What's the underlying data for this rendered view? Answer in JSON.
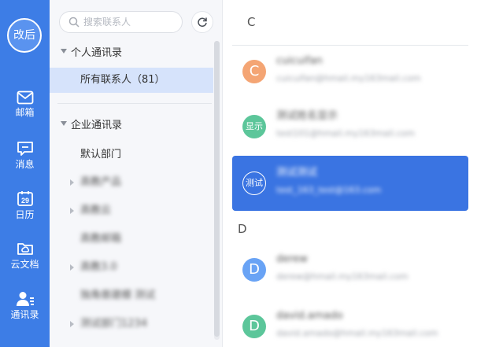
{
  "colors": {
    "nav_bg": "#3d7de6",
    "selected_bg": "#3a74e2",
    "active_row_bg": "#d6e3fb"
  },
  "nav": {
    "avatar_text": "改后",
    "items": [
      {
        "label": "邮箱",
        "icon": "mail-icon"
      },
      {
        "label": "消息",
        "icon": "message-icon"
      },
      {
        "label": "日历",
        "icon": "calendar-icon",
        "icon_text": "29"
      },
      {
        "label": "云文档",
        "icon": "cloud-folder-icon"
      },
      {
        "label": "通讯录",
        "icon": "contacts-icon",
        "active": true
      }
    ]
  },
  "sidebar": {
    "search_placeholder": "搜索联系人",
    "personal": {
      "title": "个人通讯录",
      "all_contacts": "所有联系人（81）"
    },
    "enterprise": {
      "title": "企业通讯录",
      "items": [
        "默认部门",
        "高教产品",
        "高教云",
        "高教邮箱",
        "高教3.0",
        "独角兽建模 测试",
        "测试部门1234"
      ]
    }
  },
  "contacts": {
    "sections": [
      {
        "letter": "C",
        "items": [
          {
            "avatar": "C",
            "color": "#f4a574",
            "name": "cuicuifan",
            "email": "cuicuifan@hmail.my163mail.com"
          },
          {
            "avatar": "显示",
            "color": "#5cc69a",
            "name": "测试姓名显示",
            "email": "test101@hmail.my163mail.com"
          },
          {
            "avatar": "测试",
            "color": "#3a74e2",
            "name": "测试测试",
            "email": "test_163_test@163.com",
            "selected": true
          }
        ]
      },
      {
        "letter": "D",
        "items": [
          {
            "avatar": "D",
            "color": "#69a3f5",
            "name": "derew",
            "email": "derew@hmail.my163mail.com"
          },
          {
            "avatar": "D",
            "color": "#5cc69a",
            "name": "david.amado",
            "email": "david.amado@hmail.my163mail.com"
          }
        ]
      }
    ]
  }
}
